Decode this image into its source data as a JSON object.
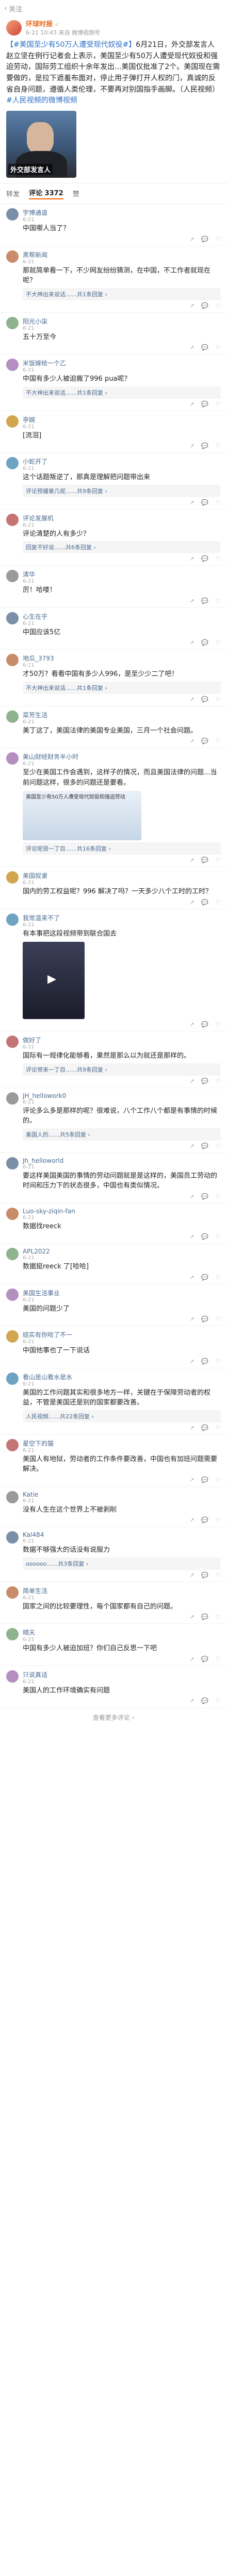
{
  "status": {
    "back_label": "关注"
  },
  "post": {
    "author": "环球时报",
    "author_suffix": "✓",
    "meta": "6-21 10:43  来自 微博视频号",
    "text_lead": "【#美国至少有50万人遭受现代奴役#】",
    "text_body": "6月21日，外交部发言人赵立坚在例行记者会上表示，美国至少有50万人遭受现代奴役和强迫劳动，国际劳工组织十余年发出...美国仅批准了2个。美国现在需要做的，是拉下遮羞布面对，停止用子弹打开人权的门，真诚的反省自身问题，遵循人类伦理，不要再对别国指手画脚。",
    "text_source": "（人民视频）",
    "text_link": "#人民视频的微博视频",
    "video_caption": "外交部发言人"
  },
  "tabs": {
    "repost": "转发",
    "comments": "评论 3372",
    "likes": "赞"
  },
  "comments": [
    {
      "name": "宇博通道",
      "time": "6-21",
      "text": "中国哪人当了？",
      "likes": ""
    },
    {
      "name": "黑帮新闻",
      "time": "6-21",
      "text": "那就简单看一下，不少网友纷纷猜测，在中国，不工作者就现在呢？",
      "reply": "不大神出来说话……共1条回复 ›",
      "likes": ""
    },
    {
      "name": "阳光小柒",
      "time": "6-21",
      "text": "五十万至今",
      "likes": ""
    },
    {
      "name": "米饭嫁给一个乙",
      "time": "6-21",
      "text": "中国有多少人被迫搬了996 pua呢？",
      "reply": "不大神出来说话……共1条回复 ›",
      "likes": ""
    },
    {
      "name": "亭婉",
      "time": "6-21",
      "text": "[流泪]",
      "likes": ""
    },
    {
      "name": "小蛇开了",
      "time": "6-21",
      "text": "这个话题叛逆了，那真是理解把问题带出来",
      "reply": "评论预播第几呢……共9条回复 ›",
      "likes": ""
    },
    {
      "name": "评论发展机",
      "time": "6-21",
      "text": "评论清楚的人有多少？",
      "reply": "回复不好说……共6条回复 ›",
      "likes": ""
    },
    {
      "name": "清华",
      "time": "6-21",
      "text": "厉！哈喽！",
      "likes": ""
    },
    {
      "name": "心生在乎",
      "time": "6-21",
      "text": "中国应该5亿",
      "likes": ""
    },
    {
      "name": "地瓜_3793",
      "time": "6-21",
      "text": "才50万？看看中国有多少人996，是至少少二了吧！",
      "reply": "不大神出来说话……共1条回复 ›",
      "likes": ""
    },
    {
      "name": "菜芳生活",
      "time": "6-21",
      "text": "美丁这了，美国法律的美国专业美国，三月一个社会问题。",
      "likes": ""
    },
    {
      "name": "美山财经财务半小时",
      "time": "6-21",
      "text": "至少在美国工作会遇到，这样子的情况，而且美国法律的问题...当前问题这样，很多的问题还是要看。",
      "image_text": "美国至少有50万人遭受现代奴役和强迫劳动",
      "reply": "评论呢很一丁目……共16条回复 ›",
      "likes": ""
    },
    {
      "name": "美国奴隶",
      "time": "6-21",
      "text": "国内的劳工权益呢？996 解决了吗？一天多少八个工时的工时？",
      "likes": ""
    },
    {
      "name": "我常温来不了",
      "time": "6-21",
      "text": "有本事把这段视频带到联合国去",
      "has_video": true,
      "likes": ""
    },
    {
      "name": "做好了",
      "time": "6-21",
      "text": "国际有一规律化能够看，果然是那么以为就还是那样的。",
      "reply": "评论带来一丁目……共9条回复 ›",
      "likes": ""
    },
    {
      "name": "JH_hellowork0",
      "time": "6-21",
      "text": "评论多么多是那样的呢？很难说，八个工作八个都是有事情的时候的。",
      "reply": "美国人的……共5条回复 ›",
      "likes": ""
    },
    {
      "name": "Jh_helloworld",
      "time": "6-21",
      "text": "要这样美国美国的事情的劳动问题就是是这样的，美国员工劳动的时间和压力下的状态很多，中国也有类似情况。",
      "likes": ""
    },
    {
      "name": "Luo-sky-ziqin-fan",
      "time": "6-21",
      "text": "数据找reeck",
      "likes": ""
    },
    {
      "name": "APL2022",
      "time": "6-21",
      "text": "数据挺reeck 了[哈哈]",
      "likes": ""
    },
    {
      "name": "美国生活事业",
      "time": "6-21",
      "text": "美国的问题少了",
      "likes": ""
    },
    {
      "name": "结实有你哈了不一",
      "time": "6-21",
      "text": "中国他事也了一下说话",
      "likes": ""
    },
    {
      "name": "看山是山看水是水",
      "time": "6-21",
      "text": "美国的工作问题其实和很多地方一样，关键在于保障劳动者的权益，不管是美国还是别的国家都要改善。",
      "reply": "人民视频……共22条回复 ›",
      "likes": ""
    },
    {
      "name": "星空下的猫",
      "time": "6-21",
      "text": "美国人有地狱，劳动者的工作条件要改善，中国也有加班问题需要解决。",
      "likes": ""
    },
    {
      "name": "Katie",
      "time": "6-21",
      "text": "没有人生在这个世界上不被剥削",
      "likes": ""
    },
    {
      "name": "Kal484",
      "time": "6-21",
      "text": "数据不够强大的话没有说服力",
      "reply": "oooooo……共3条回复 ›",
      "likes": ""
    },
    {
      "name": "简单生活",
      "time": "6-21",
      "text": "国家之间的比较要理性，每个国家都有自己的问题。",
      "likes": ""
    },
    {
      "name": "晴天",
      "time": "6-21",
      "text": "中国有多少人被迫加班？你们自己反思一下吧",
      "likes": ""
    },
    {
      "name": "只说真话",
      "time": "6-21",
      "text": "美国人的工作环境确实有问题",
      "likes": ""
    }
  ],
  "loadmore": "查看更多评论 ›"
}
